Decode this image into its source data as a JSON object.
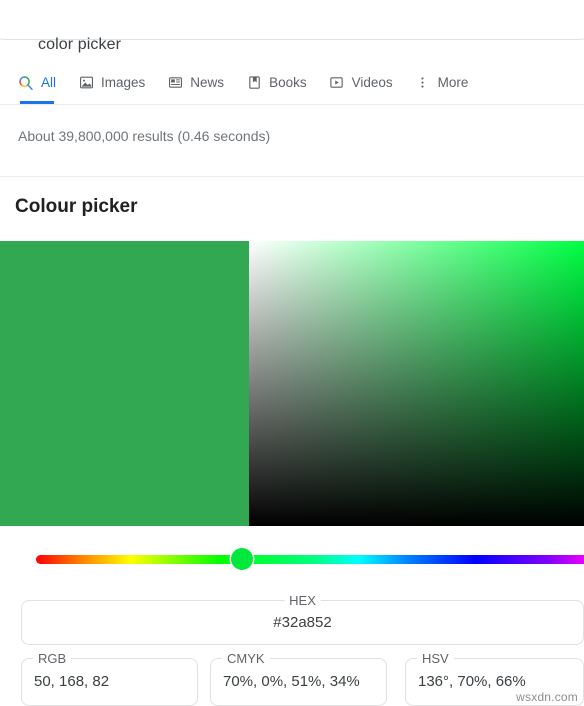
{
  "search": {
    "query": "color picker",
    "icon": "search-icon"
  },
  "nav": {
    "tabs": [
      {
        "label": "All",
        "icon": "google-search-icon",
        "active": true
      },
      {
        "label": "Images",
        "icon": "image-icon",
        "active": false
      },
      {
        "label": "News",
        "icon": "news-icon",
        "active": false
      },
      {
        "label": "Books",
        "icon": "book-icon",
        "active": false
      },
      {
        "label": "Videos",
        "icon": "video-icon",
        "active": false
      },
      {
        "label": "More",
        "icon": "more-vertical-icon",
        "active": false
      }
    ],
    "active_underline_color": "#1a73e8"
  },
  "results": {
    "stats": "About 39,800,000 results (0.46 seconds)"
  },
  "panel": {
    "title": "Colour picker",
    "selected_color": "#32a852",
    "hue_thumb_color": "#00e83c",
    "hue_position_percent": 37,
    "fields": {
      "hex": {
        "label": "HEX",
        "value": "#32a852"
      },
      "rgb": {
        "label": "RGB",
        "value": "50, 168, 82"
      },
      "cmyk": {
        "label": "CMYK",
        "value": "70%, 0%, 51%, 34%"
      },
      "hsv": {
        "label": "HSV",
        "value": "136°, 70%, 66%"
      }
    }
  },
  "watermark": "wsxdn.com"
}
